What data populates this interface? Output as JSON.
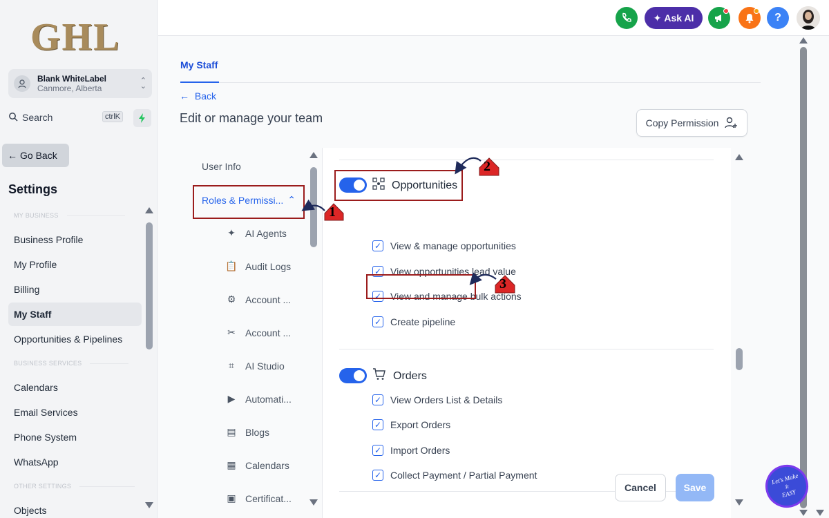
{
  "brand": {
    "logo_text": "GHL"
  },
  "account": {
    "name": "Blank WhiteLabel",
    "location": "Canmore, Alberta"
  },
  "search": {
    "label": "Search",
    "shortcut": "ctrlK"
  },
  "sidebar": {
    "go_back": "Go Back",
    "settings_title": "Settings",
    "sections": {
      "my_business": "MY BUSINESS",
      "business_services": "BUSINESS SERVICES",
      "other_settings": "OTHER SETTINGS"
    },
    "items": [
      {
        "label": "Business Profile"
      },
      {
        "label": "My Profile"
      },
      {
        "label": "Billing"
      },
      {
        "label": "My Staff",
        "active": true
      },
      {
        "label": "Opportunities & Pipelines"
      },
      {
        "label": "Calendars"
      },
      {
        "label": "Email Services"
      },
      {
        "label": "Phone System"
      },
      {
        "label": "WhatsApp"
      },
      {
        "label": "Objects"
      }
    ]
  },
  "topbar": {
    "ask_ai": "Ask AI"
  },
  "main": {
    "tab": "My Staff",
    "back": "Back",
    "heading": "Edit or manage your team",
    "copy_permission": "Copy Permission"
  },
  "inner_nav": [
    {
      "label": "User Info"
    },
    {
      "label": "Roles & Permissi...",
      "active": true
    },
    {
      "label": "AI Agents"
    },
    {
      "label": "Audit Logs"
    },
    {
      "label": "Account ..."
    },
    {
      "label": "Account ..."
    },
    {
      "label": "AI Studio"
    },
    {
      "label": "Automati..."
    },
    {
      "label": "Blogs"
    },
    {
      "label": "Calendars"
    },
    {
      "label": "Certificat..."
    }
  ],
  "permissions": {
    "opportunities": {
      "title": "Opportunities",
      "enabled": true,
      "items": [
        {
          "label": "View & manage opportunities",
          "checked": true
        },
        {
          "label": "View opportunities lead value",
          "checked": true
        },
        {
          "label": "View and manage bulk actions",
          "checked": true
        },
        {
          "label": "Create pipeline",
          "checked": true
        }
      ]
    },
    "orders": {
      "title": "Orders",
      "enabled": true,
      "items": [
        {
          "label": "View Orders List & Details",
          "checked": true
        },
        {
          "label": "Export Orders",
          "checked": true
        },
        {
          "label": "Import Orders",
          "checked": true
        },
        {
          "label": "Collect Payment / Partial Payment",
          "checked": true
        }
      ]
    }
  },
  "actions": {
    "cancel": "Cancel",
    "save": "Save"
  },
  "annotations": {
    "step1": "1",
    "step2": "2",
    "step3": "3"
  },
  "watermark": {
    "text": "Let's Make It EASY"
  },
  "colors": {
    "accent": "#2563eb",
    "annotation": "#9b1c1c",
    "badge_red": "#dc2626",
    "ask_ai": "#4c2ea8"
  }
}
